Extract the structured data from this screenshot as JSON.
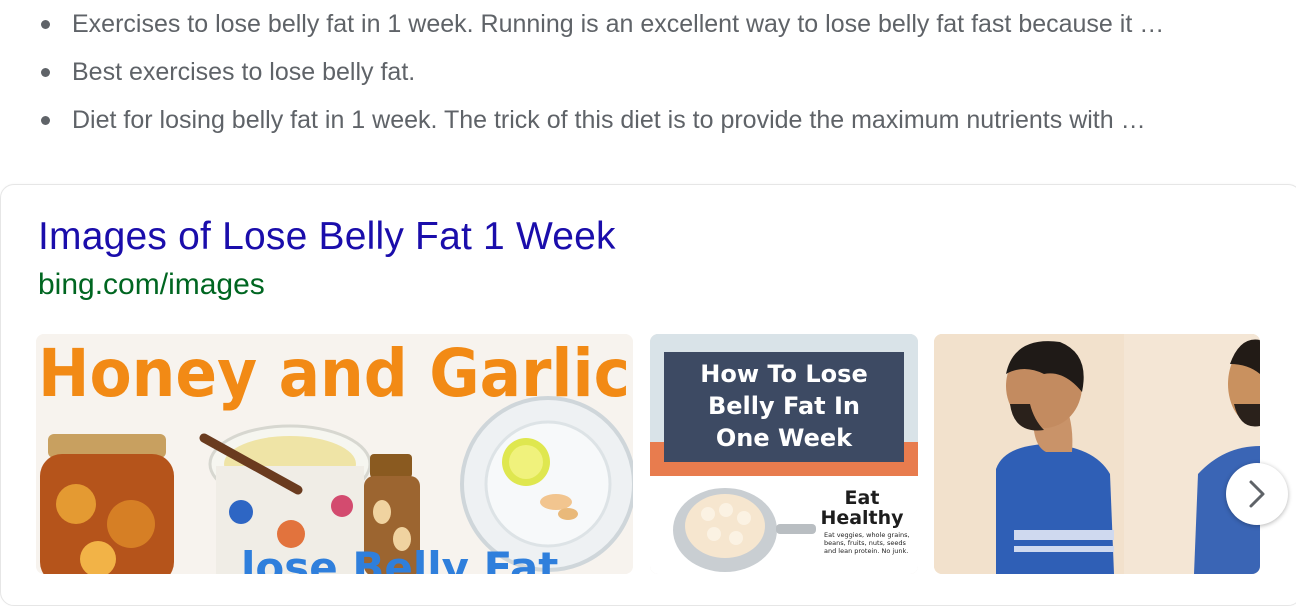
{
  "bullets": [
    "Exercises to lose belly fat in 1 week. Running is an excellent way to lose belly fat fast because it …",
    "Best exercises to lose belly fat.",
    "Diet for losing belly fat in 1 week. The trick of this diet is to provide the maximum nutrients with …"
  ],
  "images_card": {
    "title": "Images of Lose Belly Fat 1 Week",
    "url": "bing.com/images",
    "thumbnails": [
      {
        "caption": "Honey and Garlic"
      },
      {
        "caption": "How To Lose Belly Fat In One Week",
        "subcaption": "Eat Healthy",
        "small_text": "Eat veggies, whole grains, beans, fruits, nuts, seeds and lean protein. No junk."
      },
      {
        "caption": ""
      }
    ],
    "next_icon": "chevron-right-icon"
  }
}
